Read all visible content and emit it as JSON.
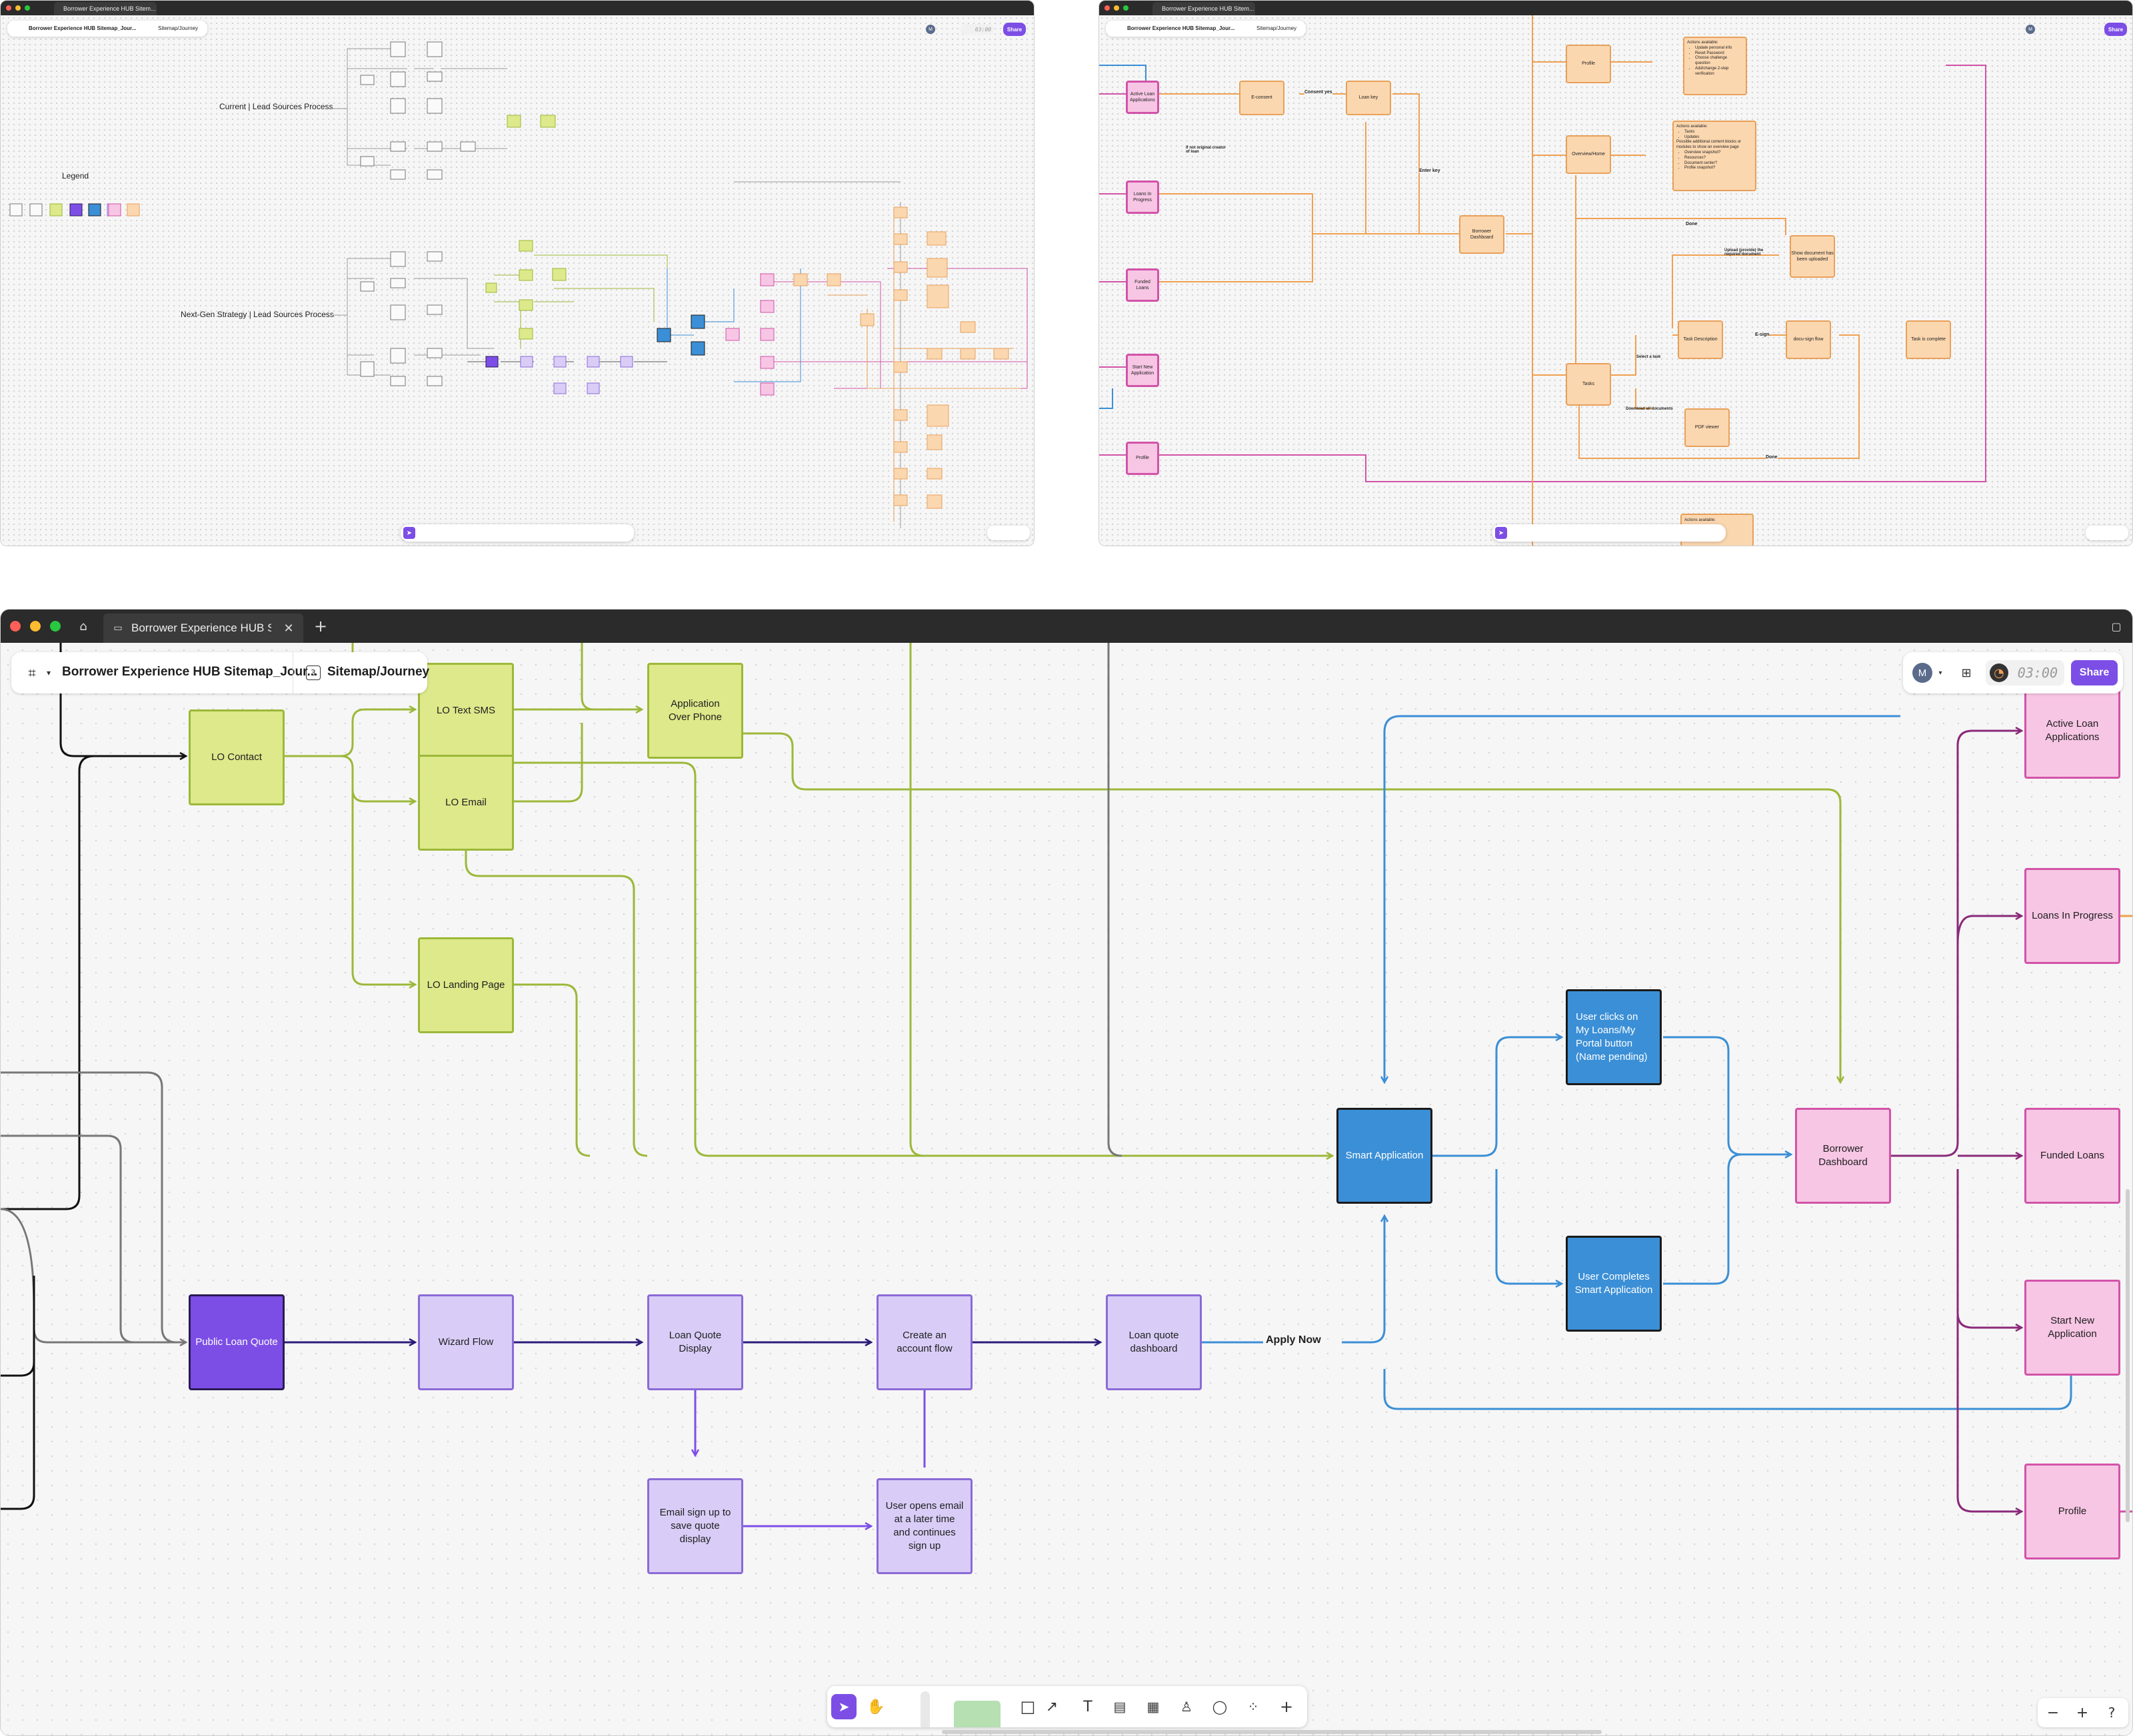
{
  "window_left": {
    "tabs": [
      "Borrower Experience HUB Sitem..."
    ],
    "file_name": "Borrower Experience HUB Sitemap_Jour...",
    "page_name": "Sitemap/Journey",
    "share_label": "Share",
    "avatar_initial": "M",
    "timer": "03:00",
    "sections": {
      "current": "Current | Lead Sources Process",
      "nextgen": "Next-Gen Strategy | Lead Sources Process",
      "legend": "Legend"
    },
    "colors": {
      "green": "#dde98a",
      "lavender": "#d9cdf7",
      "purple": "#7c4ee6",
      "blue": "#3b8fd6",
      "pink": "#f7c6e4",
      "peach": "#fbd7b0"
    }
  },
  "window_right": {
    "tabs": [
      "Borrower Experience HUB Sitem..."
    ],
    "file_name": "Borrower Experience HUB Sitemap_Jour...",
    "page_name": "Sitemap/Journey",
    "share_label": "Share",
    "avatar_initial": "M",
    "nodes": {
      "active_loan_apps": "Active Loan Applications",
      "loans_in_progress": "Loans In Progress",
      "funded_loans": "Funded Loans",
      "start_new_app": "Start New Application",
      "profile_pink": "Profile",
      "e_consent": "E-consent",
      "loan_key": "Loan key",
      "borrower_dashboard": "Borrower Dashboard",
      "profile_peach": "Profile",
      "overview_home": "Overview/Home",
      "tasks": "Tasks",
      "task_description": "Task Description",
      "docu_sign_flow": "docu-sign flow",
      "task_complete": "Task is complete",
      "show_document": "Show document has been uploaded",
      "pdf_viewer": "PDF viewer"
    },
    "edge_labels": {
      "consent_yes": "Consent yes",
      "not_original": "If not original creator of loan",
      "enter_key": "Enter key",
      "done_top": "Done",
      "upload": "Upload (provide) the required document",
      "select_task": "Select a task",
      "e_sign": "E-sign",
      "download_all": "Download all documents",
      "done_bottom": "Done"
    },
    "profile_actions": {
      "title": "Actions available:",
      "items": [
        "Update personal info",
        "Reset Password",
        "Choose challenge question",
        "Add/change 2-step verification"
      ]
    },
    "overview_actions": {
      "title": "Actions available:",
      "items": [
        "Tasks",
        "Updates"
      ],
      "note": "Possible additional content blocks or modules to show on overview page",
      "extra": [
        "Overview snapshot?",
        "Resources?",
        "Document center?",
        "Profile snapshot?"
      ]
    },
    "bottom_card": "Actions available:"
  },
  "window_main": {
    "tabs": [
      {
        "label": "Borrower Experience HUB Sitem..."
      }
    ],
    "new_tab": "+",
    "file_name": "Borrower Experience HUB Sitemap_Jour...",
    "page_number": "3",
    "page_name": "Sitemap/Journey",
    "avatar_initial": "M",
    "timer": "03:00",
    "share_label": "Share",
    "nodes": {
      "lo_contact": "LO Contact",
      "lo_text_sms": "LO Text SMS",
      "app_over_phone": "Application Over Phone",
      "lo_email": "LO Email",
      "lo_landing_page": "LO Landing Page",
      "public_loan_quote": "Public Loan Quote",
      "wizard_flow": "Wizard Flow",
      "loan_quote_display": "Loan Quote Display",
      "create_account_flow": "Create an account flow",
      "loan_quote_dashboard": "Loan quote dashboard",
      "email_sign_up": "Email sign up to save quote display",
      "user_opens_email": "User opens email at a later time and continues sign up",
      "smart_application": "Smart Application",
      "user_clicks_my_loans": "User clicks on My Loans/My Portal button (Name pending)",
      "user_completes_smart": "User Completes Smart Application",
      "borrower_dashboard": "Borrower Dashboard",
      "active_loan_apps": "Active Loan Applications",
      "loans_in_progress": "Loans In Progress",
      "funded_loans": "Funded Loans",
      "start_new_app": "Start New Application",
      "profile": "Profile"
    },
    "edge_labels": {
      "apply_now": "Apply Now"
    },
    "zoom": {
      "minus": "−",
      "plus": "+",
      "help": "?"
    },
    "tools": [
      "move-tool",
      "hand-tool",
      "marker-tool",
      "highlighter-tool",
      "shape-tool",
      "connector-tool",
      "text-tool",
      "section-tool",
      "table-tool",
      "stamp-tool",
      "comment-tool",
      "widgets-tool",
      "more-tool"
    ]
  }
}
